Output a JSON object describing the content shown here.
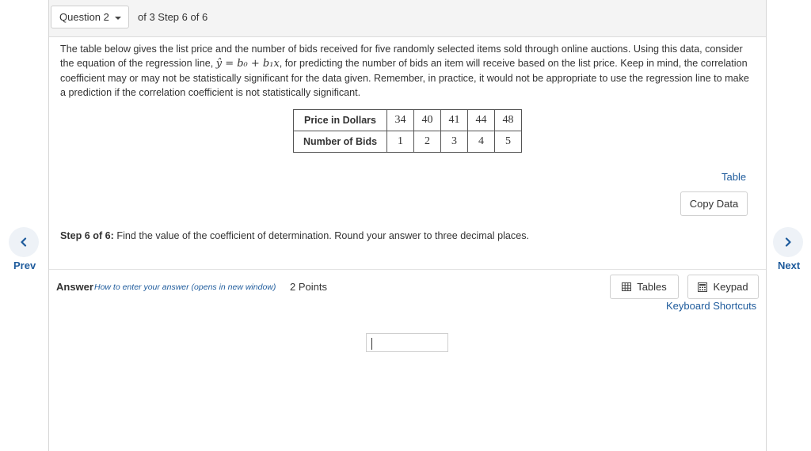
{
  "header": {
    "question_select": "Question 2",
    "step_info": "of 3 Step 6 of 6"
  },
  "problem": {
    "text_before_eq": "The table below gives the list price and the number of bids received for five randomly selected items sold through online auctions. Using this data, consider the equation of the regression line, ",
    "equation": "ŷ = b₀ + b₁x",
    "text_after_eq": ", for predicting the number of bids an item will receive based on the list price. Keep in mind, the correlation coefficient may or may not be statistically significant for the data given. Remember, in practice, it would not be appropriate to use the regression line to make a prediction if the correlation coefficient is not statistically significant."
  },
  "data_table": {
    "rows": [
      {
        "header": "Price in Dollars",
        "values": [
          "34",
          "40",
          "41",
          "44",
          "48"
        ]
      },
      {
        "header": "Number of Bids",
        "values": [
          "1",
          "2",
          "3",
          "4",
          "5"
        ]
      }
    ]
  },
  "table_link": "Table",
  "copy_data_label": "Copy Data",
  "step": {
    "label": "Step 6 of 6:",
    "text": " Find the value of the coefficient of determination. Round your answer to three decimal places."
  },
  "answer": {
    "label": "Answer",
    "howto_link": "How to enter your answer (opens in new window)",
    "points": "2 Points",
    "value": ""
  },
  "tools": {
    "tables_label": "Tables",
    "keypad_label": "Keypad",
    "keyboard_shortcuts": "Keyboard Shortcuts"
  },
  "nav": {
    "prev_label": "Prev",
    "next_label": "Next"
  },
  "colors": {
    "link": "#1e5b9c",
    "nav_circle": "#eef2f7"
  }
}
